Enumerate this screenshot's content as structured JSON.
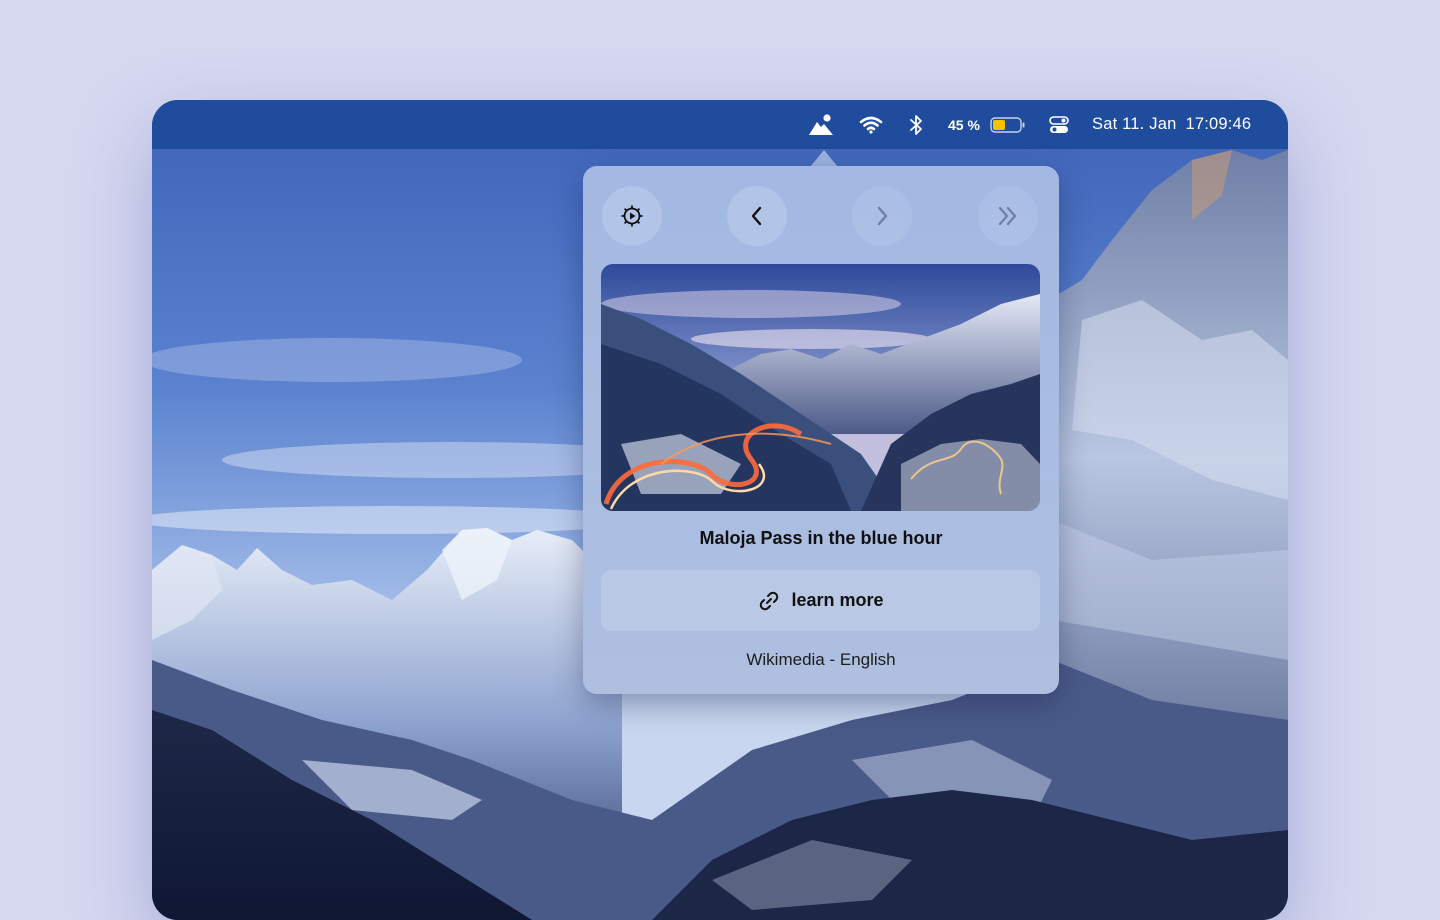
{
  "menubar": {
    "battery_percent": "45 %",
    "battery_level": 0.45,
    "date": "Sat 11. Jan",
    "time": "17:09:46",
    "icons": [
      "mountain-app-icon",
      "wifi-icon",
      "bluetooth-icon",
      "battery-icon",
      "control-center-icon"
    ]
  },
  "popover": {
    "toolbar": {
      "icons": [
        "settings-icon",
        "chevron-left-icon",
        "chevron-right-icon",
        "chevron-double-right-icon"
      ]
    },
    "photo_title": "Maloja Pass in the blue hour",
    "learn_more_label": "learn more",
    "learn_more_icon": "link-icon",
    "source": "Wikimedia - English"
  },
  "colors": {
    "menubar": "#1f4c9c",
    "popover": "#a9bce2",
    "battery_fill": "#f5c400",
    "page_background": "#d7d9f1"
  }
}
